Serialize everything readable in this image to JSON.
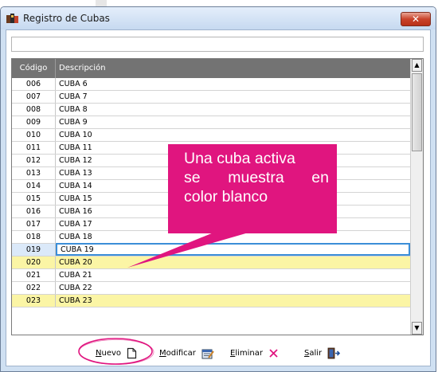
{
  "window": {
    "title": "Registro de Cubas",
    "close_label": "✕",
    "title_icon": "cuba-app-icon"
  },
  "grid": {
    "columns": [
      "Código",
      "Descripción"
    ],
    "rows": [
      {
        "code": "006",
        "desc": "CUBA 6",
        "state": "active"
      },
      {
        "code": "007",
        "desc": "CUBA 7",
        "state": "active"
      },
      {
        "code": "008",
        "desc": "CUBA 8",
        "state": "active"
      },
      {
        "code": "009",
        "desc": "CUBA 9",
        "state": "active"
      },
      {
        "code": "010",
        "desc": "CUBA 10",
        "state": "active"
      },
      {
        "code": "011",
        "desc": "CUBA 11",
        "state": "active"
      },
      {
        "code": "012",
        "desc": "CUBA 12",
        "state": "active"
      },
      {
        "code": "013",
        "desc": "CUBA 13",
        "state": "active"
      },
      {
        "code": "014",
        "desc": "CUBA 14",
        "state": "active"
      },
      {
        "code": "015",
        "desc": "CUBA 15",
        "state": "active"
      },
      {
        "code": "016",
        "desc": "CUBA 16",
        "state": "active"
      },
      {
        "code": "017",
        "desc": "CUBA 17",
        "state": "active"
      },
      {
        "code": "018",
        "desc": "CUBA 18",
        "state": "active"
      },
      {
        "code": "019",
        "desc": "CUBA 19",
        "state": "current"
      },
      {
        "code": "020",
        "desc": "CUBA 20",
        "state": "inactive"
      },
      {
        "code": "021",
        "desc": "CUBA 21",
        "state": "active"
      },
      {
        "code": "022",
        "desc": "CUBA 22",
        "state": "active"
      },
      {
        "code": "023",
        "desc": "CUBA 23",
        "state": "inactive"
      }
    ]
  },
  "callout": {
    "line1": "Una cuba activa",
    "line2": "se  muestra  en",
    "line3": "color blanco"
  },
  "toolbar": {
    "nuevo": {
      "accel": "N",
      "rest": "uevo",
      "icon": "new-document-icon"
    },
    "modificar": {
      "accel": "M",
      "rest": "odificar",
      "icon": "edit-calendar-icon"
    },
    "eliminar": {
      "accel": "E",
      "rest": "liminar",
      "icon": "delete-x-icon"
    },
    "salir": {
      "accel": "S",
      "rest": "alir",
      "icon": "exit-door-icon"
    }
  },
  "colors": {
    "inactive_row": "#fbf5a5",
    "callout": "#e0157f",
    "selection_border": "#3b8ed8",
    "header": "#737373",
    "close_button": "#c9432b",
    "delete_x": "#e0157f",
    "highlight_oval": "#e0157f"
  }
}
